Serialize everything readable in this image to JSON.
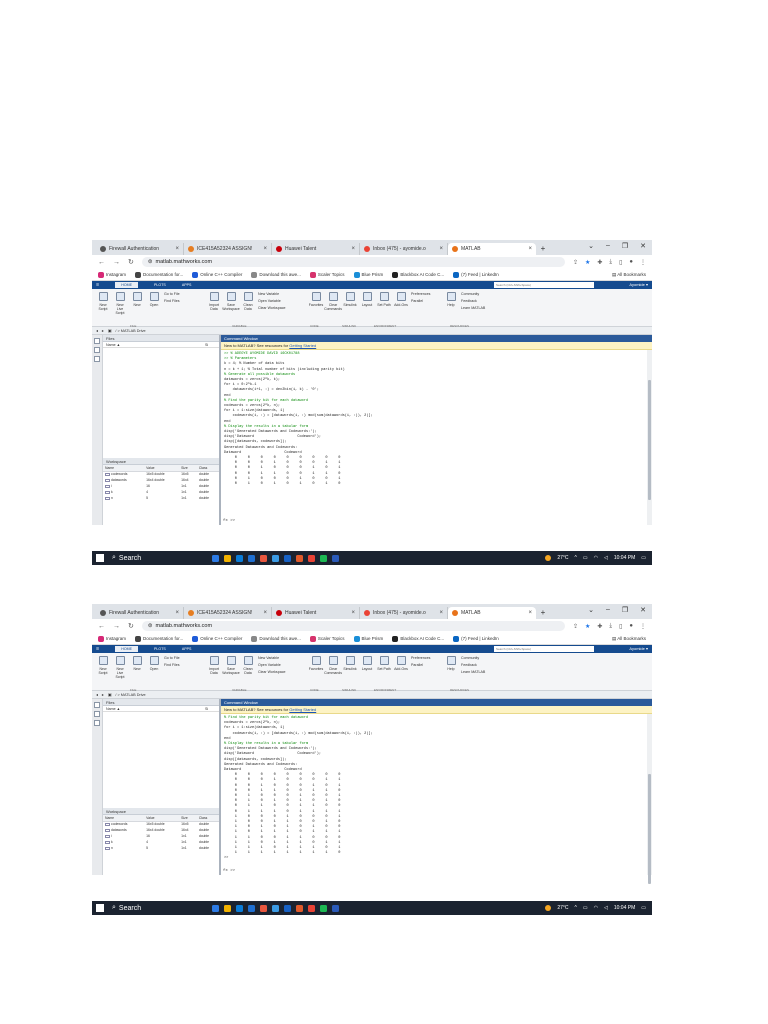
{
  "colors": {
    "matlab_blue": "#154b8f",
    "command_header": "#2b5a9a",
    "banner_bg": "#fdf3c4",
    "taskbar": "#1b2330",
    "comment_green": "#0a8a0a",
    "string_purple": "#a020f0"
  },
  "browser": {
    "tabs": [
      {
        "label": "Firewall Authentication",
        "icon": "globe-icon"
      },
      {
        "label": "ICE415A52324 ASSIGN!",
        "icon": "book-icon"
      },
      {
        "label": "Huawei Talent",
        "icon": "huawei-icon"
      },
      {
        "label": "Inbox (475) - ayomide.o",
        "icon": "gmail-icon"
      },
      {
        "label": "MATLAB",
        "icon": "matlab-icon"
      }
    ],
    "close_glyph": "×",
    "new_tab": "+",
    "url": "matlab.mathworks.com",
    "bookmarks": [
      {
        "label": "Instagram",
        "color": "#d62976"
      },
      {
        "label": "Documentation for...",
        "color": "#444444"
      },
      {
        "label": "Online C++ Compiler",
        "color": "#1e5bd8"
      },
      {
        "label": "Download this awe...",
        "color": "#888888"
      },
      {
        "label": "Scaler Topics",
        "color": "#d6336c"
      },
      {
        "label": "Blue Prism",
        "color": "#1a8fd8"
      },
      {
        "label": "Blackbox AI Code C...",
        "color": "#222222"
      },
      {
        "label": "(7) Feed | LinkedIn",
        "color": "#0a66c2"
      }
    ],
    "all_bookmarks": "All Bookmarks"
  },
  "matlab": {
    "tabs": [
      "HOME",
      "PLOTS",
      "APPS"
    ],
    "search_placeholder": "Search (Ctrl+Shift+Space)",
    "account": "Ayomide",
    "ribbon": {
      "new_script": "New Script",
      "new_live_script": "New Live Script",
      "new": "New",
      "open": "Open",
      "go_to_file": "Go to File",
      "find_files": "Find Files",
      "import_data": "Import Data",
      "save_workspace": "Save Workspace",
      "clean_data": "Clean Data",
      "new_variable": "New Variable",
      "open_variable": "Open Variable",
      "clear_workspace": "Clear Workspace",
      "favorites": "Favorites",
      "clear_commands": "Clear Commands",
      "simulink": "Simulink",
      "layout": "Layout",
      "set_path": "Set Path",
      "add_ons": "Add-Ons",
      "preferences": "Preferences",
      "parallel": "Parallel",
      "help": "Help",
      "community": "Community",
      "feedback": "Feedback",
      "learn_matlab": "Learn MATLAB",
      "sections": [
        "FILE",
        "VARIABLE",
        "CODE",
        "SIMULINK",
        "ENVIRONMENT",
        "RESOURCES"
      ]
    },
    "current_folder": "/ > MATLAB Drive",
    "files_title": "Files",
    "files_header": {
      "name": "Name ▲",
      "sz": "Si"
    },
    "workspace_title": "Workspace",
    "workspace_headers": [
      "Name",
      "Value",
      "Size",
      "Class"
    ],
    "workspace_rows": [
      [
        "codewords",
        "16x5 double",
        "16x5",
        "double"
      ],
      [
        "datawords",
        "16x4 double",
        "16x4",
        "double"
      ],
      [
        "i",
        "16",
        "1x1",
        "double"
      ],
      [
        "k",
        "4",
        "1x1",
        "double"
      ],
      [
        "n",
        "5",
        "1x1",
        "double"
      ]
    ],
    "command_title": "Command Window",
    "banner_text": "New to MATLAB? See resources for ",
    "banner_link": "Getting Started",
    "prompt": "fx >>"
  },
  "code1": [
    ">> % ADEOYE AYOMIDE DAVID 16CK01788",
    ">> % Parameters",
    "k = 4; % Number of data bits",
    "n = k + 1; % Total number of bits (including parity bit)",
    "",
    "% Generate all possible datawords",
    "datawords = zeros(2^k, k);",
    "for i = 0:2^k-1",
    "    datawords(i+1, :) = dec2bin(i, k) - '0';",
    "end",
    "",
    "% Find the parity bit for each dataword",
    "codewords = zeros(2^k, n);",
    "for i = 1:size(datawords, 1)",
    "    codewords(i, :) = [datawords(i, :) mod(sum(datawords(i, :)), 2)];",
    "end",
    "",
    "% Display the results in a tabular form",
    "disp('Generated Datawords and Codewords:');",
    "disp('Dataword                    Codeword');",
    "disp([datawords, codewords]);",
    "Generated Datawords and Codewords:",
    "Dataword                    Codeword",
    "     0     0     0     0     0     0     0     0     0",
    "     0     0     0     1     0     0     0     1     1",
    "     0     0     1     0     0     0     1     0     1",
    "     0     0     1     1     0     0     1     1     0",
    "     0     1     0     0     0     1     0     0     1",
    "     0     1     0     1     0     1     0     1     0"
  ],
  "code2": [
    "% Find the parity bit for each dataword",
    "codewords = zeros(2^k, n);",
    "for i = 1:size(datawords, 1)",
    "    codewords(i, :) = [datawords(i, :) mod(sum(datawords(i, :)), 2)];",
    "end",
    "",
    "% Display the results in a tabular form",
    "disp('Generated Datawords and Codewords:');",
    "disp('Dataword                    Codeword');",
    "disp([datawords, codewords]);",
    "Generated Datawords and Codewords:",
    "Dataword                    Codeword",
    "     0     0     0     0     0     0     0     0     0",
    "     0     0     0     1     0     0     0     1     1",
    "     0     0     1     0     0     0     1     0     1",
    "     0     0     1     1     0     0     1     1     0",
    "     0     1     0     0     0     1     0     0     1",
    "     0     1     0     1     0     1     0     1     0",
    "     0     1     1     0     0     1     1     0     0",
    "     0     1     1     1     0     1     1     1     1",
    "     1     0     0     0     1     0     0     0     1",
    "     1     0     0     1     1     0     0     1     0",
    "     1     0     1     0     1     0     1     0     0",
    "     1     0     1     1     1     0     1     1     1",
    "     1     1     0     0     1     1     0     0     0",
    "     1     1     0     1     1     1     0     1     1",
    "     1     1     1     0     1     1     1     0     1",
    "     1     1     1     1     1     1     1     1     0",
    "",
    ">>"
  ],
  "taskbar": {
    "search": "Search",
    "temperature": "27°C",
    "time": "10:04 PM",
    "apps": [
      "#2d7be5",
      "#f2b200",
      "#0a7cd8",
      "#1f6fd1",
      "#e8573f",
      "#3b9be5",
      "#1761c4",
      "#e05a2b",
      "#ea4335",
      "#1db954",
      "#2b5ab8"
    ]
  }
}
